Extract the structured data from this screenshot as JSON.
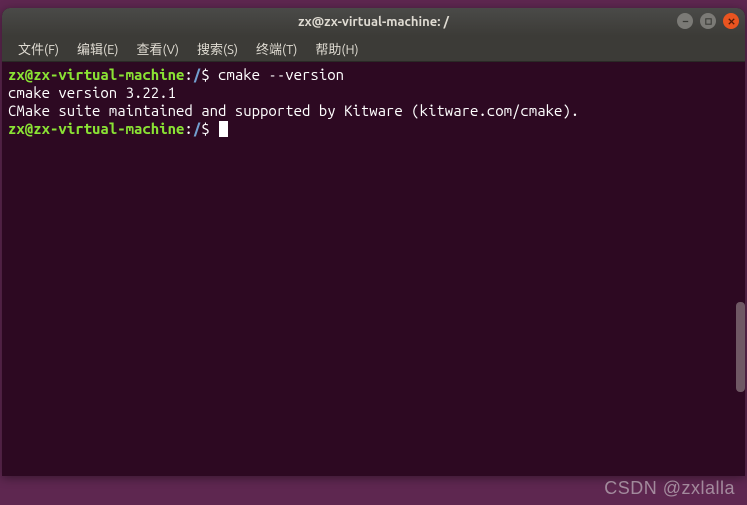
{
  "window": {
    "title": "zx@zx-virtual-machine: /"
  },
  "menubar": {
    "items": [
      {
        "label": "文件(F)"
      },
      {
        "label": "编辑(E)"
      },
      {
        "label": "查看(V)"
      },
      {
        "label": "搜索(S)"
      },
      {
        "label": "终端(T)"
      },
      {
        "label": "帮助(H)"
      }
    ]
  },
  "terminal": {
    "prompt1": {
      "user": "zx@zx-virtual-machine",
      "sep1": ":",
      "path": "/",
      "sep2": "$ ",
      "command": "cmake --version"
    },
    "output_lines": [
      "cmake version 3.22.1",
      "",
      "CMake suite maintained and supported by Kitware (kitware.com/cmake)."
    ],
    "prompt2": {
      "user": "zx@zx-virtual-machine",
      "sep1": ":",
      "path": "/",
      "sep2": "$ "
    }
  },
  "watermark": "CSDN @zxlalla"
}
